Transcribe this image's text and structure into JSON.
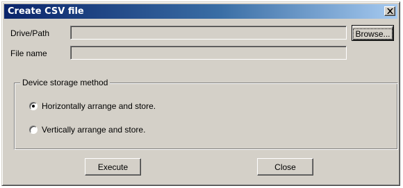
{
  "window": {
    "title": "Create CSV file"
  },
  "drive_path": {
    "label": "Drive/Path",
    "value": "",
    "browse_label": "Browse..."
  },
  "file_name": {
    "label": "File name",
    "value": ""
  },
  "storage": {
    "legend": "Device storage method",
    "options": [
      {
        "label": "Horizontally arrange and store.",
        "selected": true
      },
      {
        "label": "Vertically arrange and store.",
        "selected": false
      }
    ]
  },
  "actions": {
    "execute_label": "Execute",
    "close_label": "Close"
  },
  "colors": {
    "title_start": "#0a246a",
    "title_end": "#a6caf0",
    "face": "#d4d0c8"
  }
}
